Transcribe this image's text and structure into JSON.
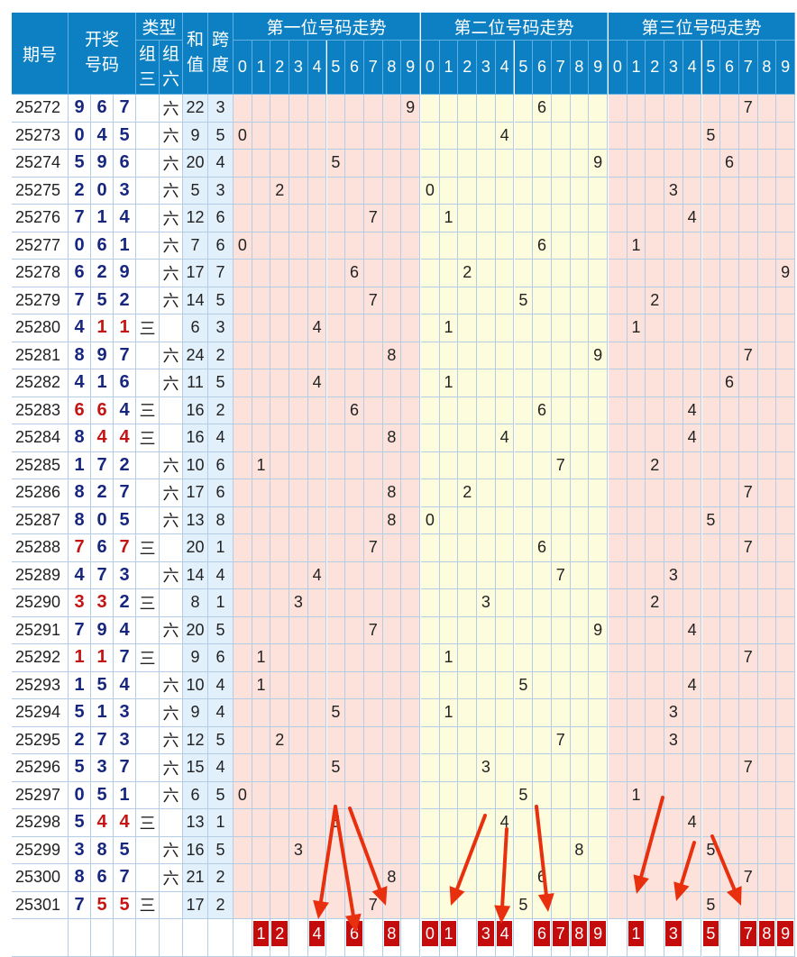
{
  "headers": {
    "period": "期号",
    "draw": "开奖号码",
    "type": "类型",
    "group3": "组三",
    "group6": "组六",
    "sum": "和值",
    "span": "跨度",
    "pos1": "第一位号码走势",
    "pos2": "第二位号码走势",
    "pos3": "第三位号码走势",
    "digits": [
      "0",
      "1",
      "2",
      "3",
      "4",
      "5",
      "6",
      "7",
      "8",
      "9"
    ]
  },
  "type_labels": {
    "group3": "三",
    "group6": "六"
  },
  "rows": [
    {
      "period": "25272",
      "n": [
        9,
        6,
        7
      ],
      "type": "六",
      "sum": "22",
      "span": "3"
    },
    {
      "period": "25273",
      "n": [
        0,
        4,
        5
      ],
      "type": "六",
      "sum": "9",
      "span": "5"
    },
    {
      "period": "25274",
      "n": [
        5,
        9,
        6
      ],
      "type": "六",
      "sum": "20",
      "span": "4"
    },
    {
      "period": "25275",
      "n": [
        2,
        0,
        3
      ],
      "type": "六",
      "sum": "5",
      "span": "3"
    },
    {
      "period": "25276",
      "n": [
        7,
        1,
        4
      ],
      "type": "六",
      "sum": "12",
      "span": "6"
    },
    {
      "period": "25277",
      "n": [
        0,
        6,
        1
      ],
      "type": "六",
      "sum": "7",
      "span": "6"
    },
    {
      "period": "25278",
      "n": [
        6,
        2,
        9
      ],
      "type": "六",
      "sum": "17",
      "span": "7"
    },
    {
      "period": "25279",
      "n": [
        7,
        5,
        2
      ],
      "type": "六",
      "sum": "14",
      "span": "5"
    },
    {
      "period": "25280",
      "n": [
        4,
        1,
        1
      ],
      "type": "三",
      "sum": "6",
      "span": "3"
    },
    {
      "period": "25281",
      "n": [
        8,
        9,
        7
      ],
      "type": "六",
      "sum": "24",
      "span": "2"
    },
    {
      "period": "25282",
      "n": [
        4,
        1,
        6
      ],
      "type": "六",
      "sum": "11",
      "span": "5"
    },
    {
      "period": "25283",
      "n": [
        6,
        6,
        4
      ],
      "type": "三",
      "sum": "16",
      "span": "2"
    },
    {
      "period": "25284",
      "n": [
        8,
        4,
        4
      ],
      "type": "三",
      "sum": "16",
      "span": "4"
    },
    {
      "period": "25285",
      "n": [
        1,
        7,
        2
      ],
      "type": "六",
      "sum": "10",
      "span": "6"
    },
    {
      "period": "25286",
      "n": [
        8,
        2,
        7
      ],
      "type": "六",
      "sum": "17",
      "span": "6"
    },
    {
      "period": "25287",
      "n": [
        8,
        0,
        5
      ],
      "type": "六",
      "sum": "13",
      "span": "8"
    },
    {
      "period": "25288",
      "n": [
        7,
        6,
        7
      ],
      "type": "三",
      "sum": "20",
      "span": "1"
    },
    {
      "period": "25289",
      "n": [
        4,
        7,
        3
      ],
      "type": "六",
      "sum": "14",
      "span": "4"
    },
    {
      "period": "25290",
      "n": [
        3,
        3,
        2
      ],
      "type": "三",
      "sum": "8",
      "span": "1"
    },
    {
      "period": "25291",
      "n": [
        7,
        9,
        4
      ],
      "type": "六",
      "sum": "20",
      "span": "5"
    },
    {
      "period": "25292",
      "n": [
        1,
        1,
        7
      ],
      "type": "三",
      "sum": "9",
      "span": "6"
    },
    {
      "period": "25293",
      "n": [
        1,
        5,
        4
      ],
      "type": "六",
      "sum": "10",
      "span": "4"
    },
    {
      "period": "25294",
      "n": [
        5,
        1,
        3
      ],
      "type": "六",
      "sum": "9",
      "span": "4"
    },
    {
      "period": "25295",
      "n": [
        2,
        7,
        3
      ],
      "type": "六",
      "sum": "12",
      "span": "5"
    },
    {
      "period": "25296",
      "n": [
        5,
        3,
        7
      ],
      "type": "六",
      "sum": "15",
      "span": "4"
    },
    {
      "period": "25297",
      "n": [
        0,
        5,
        1
      ],
      "type": "六",
      "sum": "6",
      "span": "5"
    },
    {
      "period": "25298",
      "n": [
        5,
        4,
        4
      ],
      "type": "三",
      "sum": "13",
      "span": "1"
    },
    {
      "period": "25299",
      "n": [
        3,
        8,
        5
      ],
      "type": "六",
      "sum": "16",
      "span": "5"
    },
    {
      "period": "25300",
      "n": [
        8,
        6,
        7
      ],
      "type": "六",
      "sum": "21",
      "span": "2"
    },
    {
      "period": "25301",
      "n": [
        7,
        5,
        5
      ],
      "type": "三",
      "sum": "17",
      "span": "2"
    }
  ],
  "predictions": {
    "pos1": [
      1,
      2,
      4,
      6,
      8
    ],
    "pos2": [
      0,
      1,
      3,
      4,
      6,
      7,
      8,
      9
    ],
    "pos3": [
      1,
      3,
      5,
      7,
      8,
      9
    ]
  },
  "colors": {
    "header_bg": "#0c80c2",
    "highlight_red": "#c40c0c",
    "repeat_digit": "#c41414",
    "digit_blue": "#17277e",
    "zone_pink": "#fde2dc",
    "zone_yellow": "#fdfcdc",
    "sum_span_bg": "#e2f0fc"
  }
}
